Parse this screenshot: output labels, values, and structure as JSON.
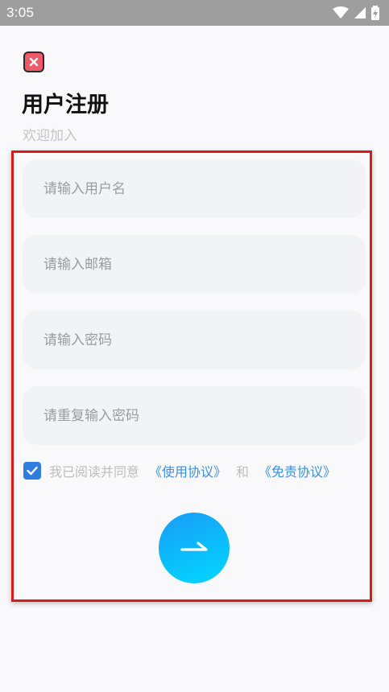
{
  "status_bar": {
    "time": "3:05",
    "icons": [
      "wifi-icon",
      "signal-icon",
      "battery-charging-icon"
    ]
  },
  "header": {
    "close_icon": "close-icon",
    "title": "用户注册",
    "subtitle": "欢迎加入"
  },
  "form": {
    "username": {
      "placeholder": "请输入用户名",
      "value": ""
    },
    "email": {
      "placeholder": "请输入邮箱",
      "value": ""
    },
    "password": {
      "placeholder": "请输入密码",
      "value": ""
    },
    "confirm_password": {
      "placeholder": "请重复输入密码",
      "value": ""
    },
    "agreement": {
      "checked": true,
      "text": "我已阅读并同意",
      "terms_link": "《使用协议》",
      "and": "和",
      "disclaimer_link": "《免责协议》"
    },
    "submit_icon": "arrow-right-icon"
  },
  "colors": {
    "close_bg": "#ef5a68",
    "accent_blue": "#2f7ddf",
    "link_blue": "#3b8fe0",
    "button_gradient_start": "#1a9cf7",
    "button_gradient_end": "#00d8ff",
    "highlight_frame": "#d91a1a",
    "field_bg": "#f2f3f6"
  }
}
